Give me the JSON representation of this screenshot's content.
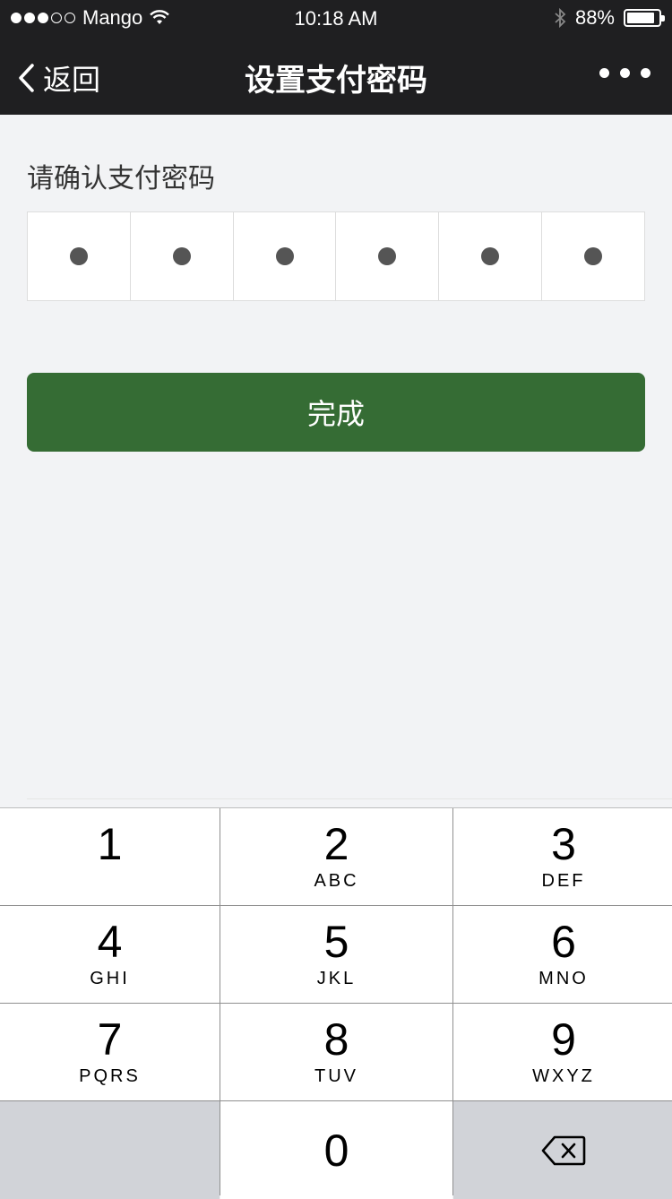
{
  "status_bar": {
    "carrier": "Mango",
    "time": "10:18 AM",
    "battery": "88%",
    "battery_level": 0.88,
    "signal_bars_filled": 3,
    "signal_bars_total": 5
  },
  "nav": {
    "back_label": "返回",
    "title": "设置支付密码"
  },
  "form": {
    "prompt": "请确认支付密码",
    "pin_length": 6,
    "filled_digits": 6,
    "submit_label": "完成"
  },
  "keypad": {
    "keys": [
      {
        "num": "1",
        "letters": ""
      },
      {
        "num": "2",
        "letters": "ABC"
      },
      {
        "num": "3",
        "letters": "DEF"
      },
      {
        "num": "4",
        "letters": "GHI"
      },
      {
        "num": "5",
        "letters": "JKL"
      },
      {
        "num": "6",
        "letters": "MNO"
      },
      {
        "num": "7",
        "letters": "PQRS"
      },
      {
        "num": "8",
        "letters": "TUV"
      },
      {
        "num": "9",
        "letters": "WXYZ"
      },
      {
        "num": "0",
        "letters": ""
      }
    ],
    "delete_icon": "backspace-icon"
  },
  "colors": {
    "nav_bg": "#1f1f21",
    "primary_button": "#356c34",
    "page_bg": "#f2f3f5"
  }
}
